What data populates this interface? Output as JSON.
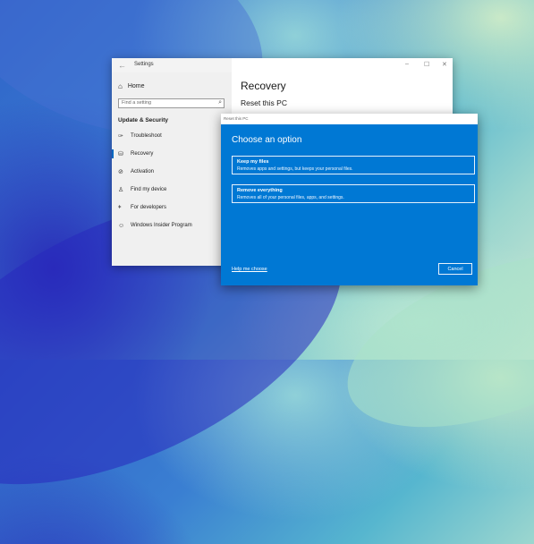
{
  "settings_window": {
    "title": "Settings",
    "controls": {
      "minimize": "–",
      "maximize": "☐",
      "close": "✕"
    },
    "sidebar": {
      "home_label": "Home",
      "search_placeholder": "Find a setting",
      "section_label": "Update & Security",
      "items": [
        {
          "label": "Troubleshoot",
          "icon": "wrench-icon",
          "glyph": "✑"
        },
        {
          "label": "Recovery",
          "icon": "recovery-icon",
          "glyph": "⛁",
          "selected": true
        },
        {
          "label": "Activation",
          "icon": "activation-icon",
          "glyph": "⊘"
        },
        {
          "label": "Find my device",
          "icon": "person-pin-icon",
          "glyph": "♙"
        },
        {
          "label": "For developers",
          "icon": "developers-icon",
          "glyph": "⧧"
        },
        {
          "label": "Windows Insider Program",
          "icon": "insider-icon",
          "glyph": "☺"
        }
      ]
    },
    "main": {
      "heading": "Recovery",
      "subheading": "Reset this PC"
    }
  },
  "reset_dialog": {
    "title": "Reset this PC",
    "heading": "Choose an option",
    "options": [
      {
        "title": "Keep my files",
        "description": "Removes apps and settings, but keeps your personal files."
      },
      {
        "title": "Remove everything",
        "description": "Removes all of your personal files, apps, and settings."
      }
    ],
    "help_link": "Help me choose",
    "cancel_label": "Cancel"
  },
  "colors": {
    "dialog_blue": "#0078d4",
    "accent": "#0067c0",
    "settings_bg": "#f3f3f3"
  }
}
